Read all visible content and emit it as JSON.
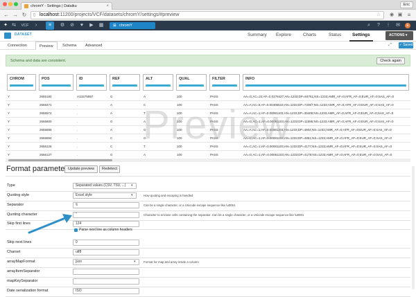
{
  "browser": {
    "tab_title": "chromY - Settings | Dataiku",
    "user": "Eric",
    "url_host": "localhost",
    "url_path": ":11200/projects/VCF/datasets/chromY/settings/#preview"
  },
  "app": {
    "project": "VCF",
    "dataset_name": "chromY"
  },
  "dataset_bar": {
    "label": "DATASET",
    "tabs": [
      "Summary",
      "Explore",
      "Charts",
      "Status",
      "Settings"
    ],
    "active_tab": "Settings",
    "actions_label": "ACTIONS"
  },
  "subtabs": {
    "items": [
      "Connection",
      "Preview",
      "Schema",
      "Advanced"
    ],
    "active": "Preview",
    "saved_label": "Saved"
  },
  "notice": {
    "text": "Schema and data are consistent.",
    "button": "Check again"
  },
  "preview": {
    "watermark": "Preview",
    "columns": [
      "CHROM",
      "POS",
      "ID",
      "REF",
      "ALT",
      "QUAL",
      "FILTER",
      "INFO"
    ],
    "rows": [
      [
        "Y",
        "2655180",
        "rs11575897",
        "G",
        "A",
        "100",
        "PASS",
        "AA=G;AC=22;AF=0.0178427;AN=1233;DP=84761;NS=1233;AMR_AF=0;AFR_AF=0;EUR_AF=0;SAS_AF=0"
      ],
      [
        "Y",
        "2655471",
        ".",
        "A",
        "C",
        "100",
        "PASS",
        "AA=A;AC=5;AF=0.00405515;AN=1233;DP=72067;NS=1233;AMR_AF=0;AFR_AF=0;EUR_AF=0;SAS_AF=0"
      ],
      [
        "Y",
        "2655574",
        ".",
        "A",
        "T",
        "100",
        "PASS",
        "AA=A;AC=1;AF=0.00081103;AN=1233;DP=30409;NS=1233;AMR_AF=0;AFR_AF=0;EUR_AF=0;SAS_AF=0"
      ],
      [
        "Y",
        "2655800",
        ".",
        "G",
        "A",
        "100",
        "PASS",
        "AA=G;AC=1;AF=0.00081103;AN=1233;DP=11595;NS=1233;AMR_AF=0;AFR_AF=0;EUR_AF=0;SAS_AF=0"
      ],
      [
        "Y",
        "2655889",
        ".",
        "A",
        "G",
        "100",
        "PASS",
        "AA=A;AC=1;AF=0.00081103;AN=1233;DP=4904;NS=1233;AMR_AF=0;AFR_AF=0;EUR_AF=0;SAS_AF=0"
      ],
      [
        "Y",
        "2655894",
        ".",
        "C",
        "G",
        "100",
        "PASS",
        "AA=C;AC=1;AF=0.00081103;AN=1233;DP=4851;NS=1233;AMR_AF=0;AFR_AF=0;EUR_AF=0;SAS_AF=0"
      ],
      [
        "Y",
        "2656126",
        ".",
        "C",
        "T",
        "100",
        "PASS",
        "AA=C;AC=1;AF=0.00081103;AN=1233;DP=4177;NS=1233;AMR_AF=0;AFR_AF=0;EUR_AF=0;SAS_AF=0"
      ],
      [
        "Y",
        "2656127",
        ".",
        "G",
        "A",
        "100",
        "PASS",
        "AA=G;AC=1;AF=0.00081103;AN=1233;DP=4178;NS=1233;AMR_AF=0;AFR_AF=0;EUR_AF=0;SAS_AF=0"
      ]
    ]
  },
  "format": {
    "title": "Format parameters",
    "update_button": "Update preview",
    "redetect_button": "Redetect",
    "fields": [
      {
        "label": "Type",
        "value": "Separated values (CSV, TSV, ...)",
        "help": ""
      },
      {
        "label": "Quoting style",
        "value": "Excel style",
        "help": "How quoting and escaping is handled"
      },
      {
        "label": "Separator",
        "value": "\\t",
        "help": "Can be a single character, or a Unicode escape sequence like \\u0051"
      },
      {
        "label": "Quoting character",
        "value": "\"",
        "help": "Character to enclose cells containing the separator. Can be a single character, or a Unicode escape sequence like \\u0001"
      },
      {
        "label": "Skip first lines",
        "value": "124",
        "help": ""
      },
      {
        "label": "Skip next lines",
        "value": "0",
        "help": ""
      },
      {
        "label": "Charset",
        "value": "utf8",
        "help": ""
      },
      {
        "label": "arrayMapFormat",
        "value": "json",
        "help": "Format for map and array inside a column"
      },
      {
        "label": "arrayItemSeparator",
        "value": "",
        "help": ""
      },
      {
        "label": "mapKeySeparator",
        "value": "",
        "help": ""
      },
      {
        "label": "Date serialization format",
        "value": "ISO",
        "help": ""
      }
    ],
    "parse_header_label": "Parse next line as column headers"
  },
  "colors": {
    "accent": "#2e8ec8",
    "app_bar": "#2b3a4a",
    "notice_bg": "#d8ecd6",
    "arrow": "#2e8ec8"
  }
}
